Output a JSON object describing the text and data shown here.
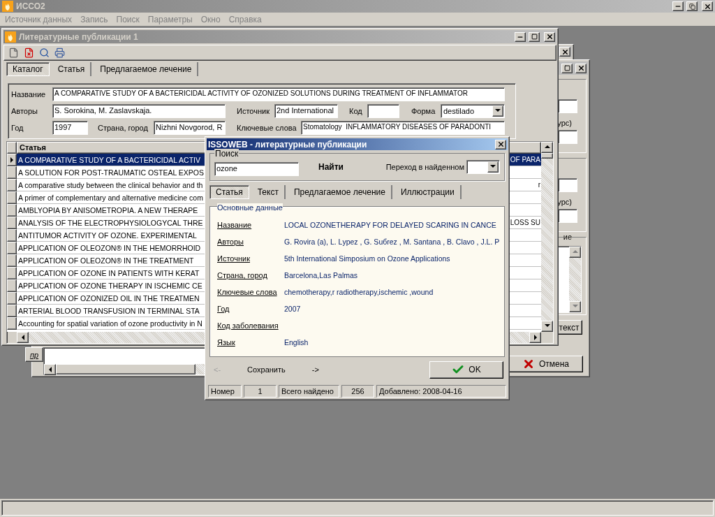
{
  "app": {
    "title": "ИССО2"
  },
  "menu": [
    {
      "label": "Источник данных"
    },
    {
      "label": "Запись"
    },
    {
      "label": "Поиск"
    },
    {
      "label": "Параметры"
    },
    {
      "label": "Окно"
    },
    {
      "label": "Справка"
    }
  ],
  "back_window": {
    "side_button": "пр",
    "labels": [
      "урс)",
      "урс)"
    ],
    "group_caption": "ие",
    "buttons": [
      {
        "label": "текст",
        "kind": "plain"
      },
      {
        "label": "Отмена",
        "kind": "cancel"
      }
    ]
  },
  "catalog_window": {
    "title": "Литературные публикации 1",
    "tabs": [
      {
        "label": "Каталог",
        "selected": true
      },
      {
        "label": "Статья",
        "selected": false
      },
      {
        "label": "Предлагаемое лечение",
        "selected": false
      }
    ],
    "form": {
      "fields": [
        {
          "label": "Название",
          "value": "A COMPARATIVE STUDY OF A BACTERICIDAL ACTIVITY OF OZONIZED SOLUTIONS DURING TREATMENT OF INFLAMMATOR",
          "kind": "text"
        },
        {
          "label": "Авторы",
          "value": "S. Sorokina, M. Zaslavskaja.",
          "kind": "text"
        },
        {
          "label": "Источник",
          "value": "2nd International",
          "kind": "text"
        },
        {
          "label": "Код",
          "kind": "text"
        },
        {
          "label": "Форма",
          "value": "destilado",
          "kind": "dropdown"
        },
        {
          "label": "Год",
          "value": "1997",
          "kind": "text"
        },
        {
          "label": "Страна, город",
          "value": "Nizhni Novgorod, R",
          "kind": "text"
        },
        {
          "label": "Ключевые слова",
          "value": "Stomatology  INFLAMMATORY DISEASES OF PARADONTI",
          "kind": "text"
        }
      ]
    },
    "grid": {
      "columns": [
        "Статья"
      ],
      "rows": [
        {
          "text": "A COMPARATIVE STUDY OF A BACTERICIDAL ACTIV",
          "tail": "OF PARA",
          "selected": true
        },
        {
          "text": "A SOLUTION FOR POST-TRAUMATIC OSTEAL EXPOS",
          "selected": false
        },
        {
          "text": "A comparative study between the clinical behavior and th",
          "tail": "r",
          "selected": false
        },
        {
          "text": "A primer of complementary and alternative medicine com",
          "selected": false
        },
        {
          "text": "AMBLYOPIA BY ANISOMETROPIA. A NEW THERAPE",
          "selected": false
        },
        {
          "text": "ANALYSIS OF THE ELECTROPHYSIOLOGYCAL THRE",
          "tail": "LOSS SU",
          "selected": false
        },
        {
          "text": "ANTITUMOR ACTIVITY OF OZONE. EXPERIMENTAL",
          "selected": false
        },
        {
          "text": "APPLICATION OF OLEOZON® IN THE HEMORRHOID",
          "selected": false
        },
        {
          "text": "APPLICATION OF OLEOZON® IN THE TREATMENT",
          "selected": false
        },
        {
          "text": "APPLICATION OF OZONE IN PATIENTS WITH KERAT",
          "selected": false
        },
        {
          "text": "APPLICATION OF OZONE THERAPY IN ISCHEMIC CE",
          "selected": false
        },
        {
          "text": "APPLICATION OF OZONIZED OIL IN THE TREATMEN",
          "selected": false
        },
        {
          "text": "ARTERIAL BLOOD TRANSFUSION IN TERMINAL STA",
          "selected": false
        },
        {
          "text": "Accounting for spatial variation of ozone productivity in N",
          "selected": false
        }
      ]
    }
  },
  "search_dialog": {
    "title": "ISSOWEB - литературные публикации",
    "search": {
      "caption": "Поиск",
      "value": "ozone",
      "button": "Найти",
      "goto_label": "Переход в найденном"
    },
    "tabs": [
      {
        "label": "Статья",
        "selected": true
      },
      {
        "label": "Текст",
        "selected": false
      },
      {
        "label": "Предлагаемое лечение",
        "selected": false
      },
      {
        "label": "Иллюстрации",
        "selected": false
      }
    ],
    "group_caption": "Основные данные",
    "details": [
      {
        "label": "Название",
        "value": "LOCAL OZONETHERAPY FOR DELAYED SCARING IN CANCE"
      },
      {
        "label": "Авторы",
        "value": "G. Rovira (a), L. Lуpez , G. Suбrez , M. Santana , B. Clavo , J.L. P"
      },
      {
        "label": "Источник",
        "value": "5th International Simposium on Ozone Applications"
      },
      {
        "label": "Страна, город",
        "value": "Barcelona,Las Palmas"
      },
      {
        "label": "Ключевые слова",
        "value": "chemotherapy,r radiotherapy,ischemic ,wound"
      },
      {
        "label": "Год",
        "value": "2007"
      },
      {
        "label": "Код заболевания"
      },
      {
        "label": "Язык",
        "value": "English"
      }
    ],
    "nav_buttons": [
      {
        "label": "<-",
        "disabled": true
      },
      {
        "label": "Сохранить",
        "disabled": false
      },
      {
        "label": "->",
        "disabled": false
      }
    ],
    "ok": "OK",
    "status": [
      "Номер",
      "1",
      "Всего найдено",
      "256",
      "Добавлено: 2008-04-16"
    ]
  }
}
